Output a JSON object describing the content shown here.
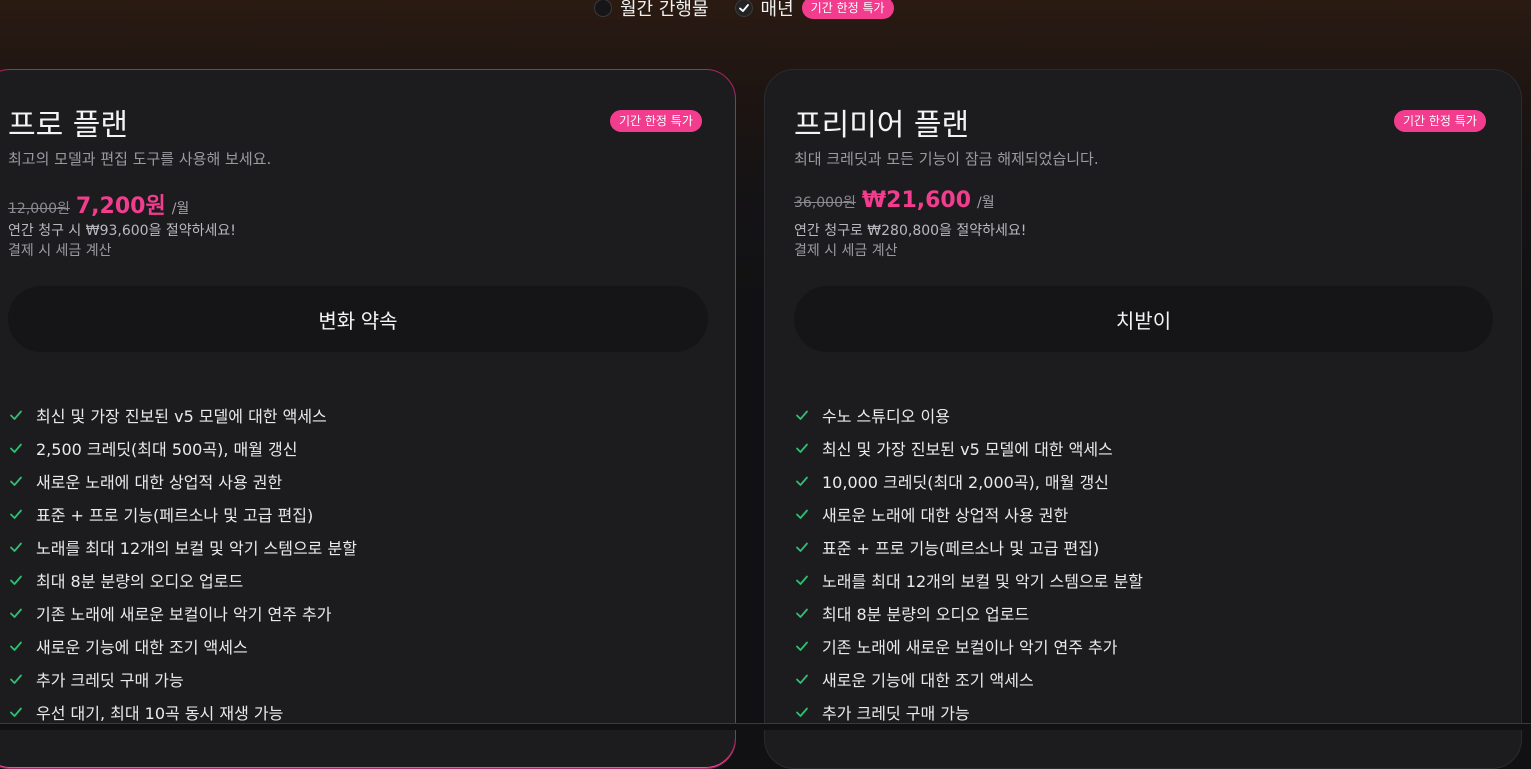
{
  "billing": {
    "monthly_label": "월간 간행물",
    "yearly_label": "매년",
    "promo_badge": "기간 한정 특가"
  },
  "plans": [
    {
      "title": "프로 플랜",
      "badge": "기간 한정 특가",
      "subtitle": "최고의 모델과 편집 도구를 사용해 보세요.",
      "old_price": "12,000원",
      "new_price": "7,200원",
      "per": "/월",
      "savings": "연간 청구 시 ₩93,600을 절약하세요!",
      "tax": "결제 시 세금 계산",
      "cta": "변화 약속",
      "features": [
        "최신 및 가장 진보된 v5 모델에 대한 액세스",
        "2,500 크레딧(최대 500곡), 매월 갱신",
        "새로운 노래에 대한 상업적 사용 권한",
        "표준 + 프로 기능(페르소나 및 고급 편집)",
        "노래를 최대 12개의 보컬 및 악기 스템으로 분할",
        "최대 8분 분량의 오디오 업로드",
        "기존 노래에 새로운 보컬이나 악기 연주 추가",
        "새로운 기능에 대한 조기 액세스",
        "추가 크레딧 구매 가능",
        "우선 대기, 최대 10곡 동시 재생 가능"
      ]
    },
    {
      "title": "프리미어 플랜",
      "badge": "기간 한정 특가",
      "subtitle": "최대 크레딧과 모든 기능이 잠금 해제되었습니다.",
      "old_price": "36,000원",
      "new_price": "₩21,600",
      "per": "/월",
      "savings": "연간 청구로 ₩280,800을 절약하세요!",
      "tax": "결제 시 세금 계산",
      "cta": "치받이",
      "features": [
        "수노 스튜디오 이용",
        "최신 및 가장 진보된 v5 모델에 대한 액세스",
        "10,000 크레딧(최대 2,000곡), 매월 갱신",
        "새로운 노래에 대한 상업적 사용 권한",
        "표준 + 프로 기능(페르소나 및 고급 편집)",
        "노래를 최대 12개의 보컬 및 악기 스템으로 분할",
        "최대 8분 분량의 오디오 업로드",
        "기존 노래에 새로운 보컬이나 악기 연주 추가",
        "새로운 기능에 대한 조기 액세스",
        "추가 크레딧 구매 가능"
      ]
    }
  ],
  "colors": {
    "accent": "#f23d8e",
    "check": "#2fbf71",
    "card_bg": "#1c1c1f"
  }
}
